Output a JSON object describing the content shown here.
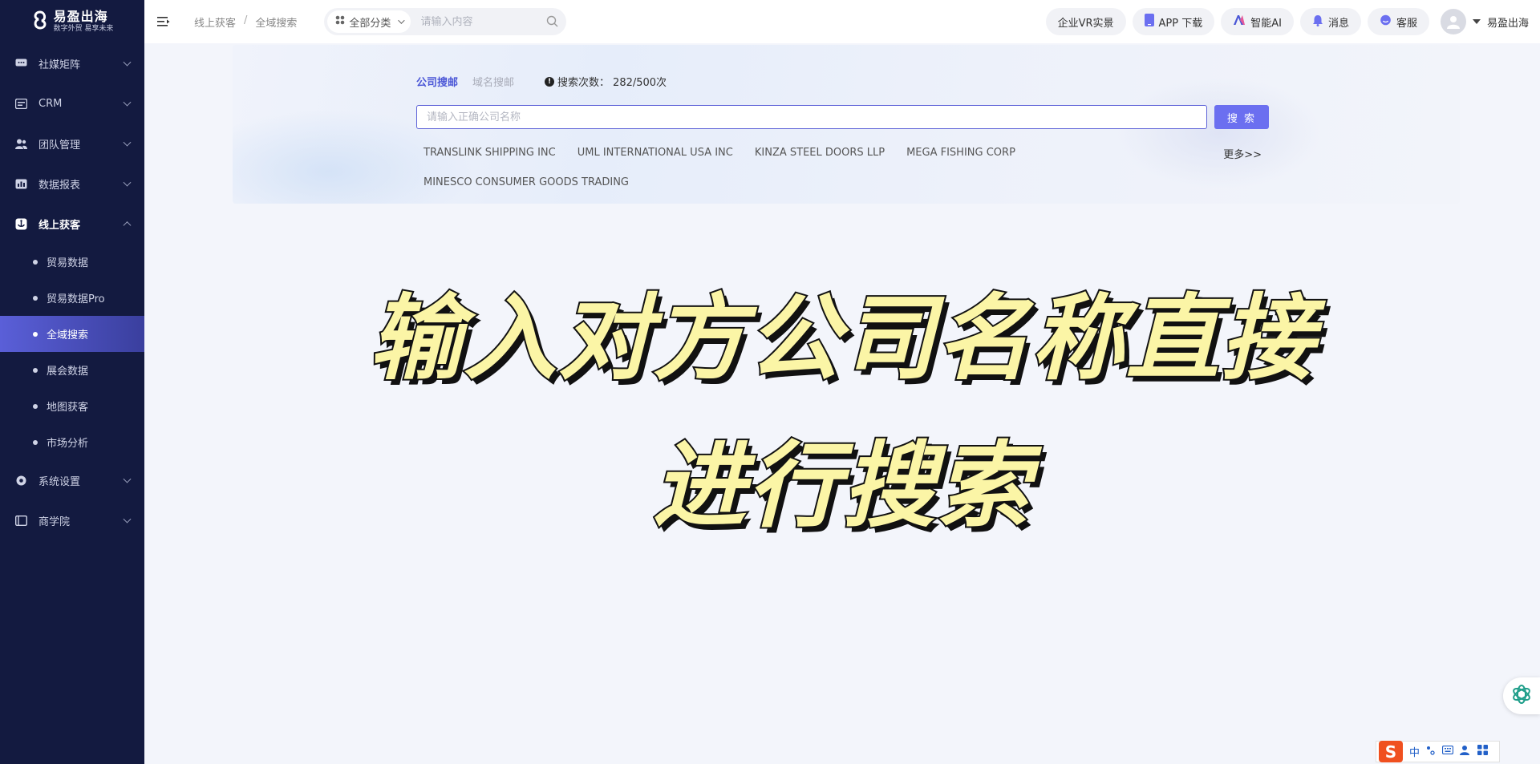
{
  "sidebar": {
    "logo_title": "易盈出海",
    "logo_subtitle": "数字外贸 易享未来",
    "items": [
      {
        "label": "社媒矩阵"
      },
      {
        "label": "CRM"
      },
      {
        "label": "团队管理"
      },
      {
        "label": "数据报表"
      },
      {
        "label": "线上获客"
      }
    ],
    "sub_items": [
      {
        "label": "贸易数据"
      },
      {
        "label": "贸易数据Pro"
      },
      {
        "label": "全域搜索"
      },
      {
        "label": "展会数据"
      },
      {
        "label": "地图获客"
      },
      {
        "label": "市场分析"
      }
    ],
    "bottom_items": [
      {
        "label": "系统设置"
      },
      {
        "label": "商学院"
      }
    ]
  },
  "header": {
    "breadcrumb": [
      "线上获客",
      "全域搜索"
    ],
    "breadcrumb_sep": "/",
    "category": "全部分类",
    "search_placeholder": "请输入内容",
    "buttons": {
      "vr": "企业VR实景",
      "app": "APP 下载",
      "ai": "智能AI",
      "msg": "消息",
      "service": "客服"
    },
    "username": "易盈出海"
  },
  "search_panel": {
    "tab_company": "公司搜邮",
    "tab_domain": "域名搜邮",
    "quota_label": "搜索次数：",
    "quota_value": "282/500次",
    "input_placeholder": "请输入正确公司名称",
    "search_button": "搜 索",
    "suggestions_row1": [
      "TRANSLINK SHIPPING INC",
      "UML INTERNATIONAL USA INC",
      "KINZA STEEL DOORS LLP",
      "MEGA FISHING CORP"
    ],
    "suggestions_row2": [
      "MINESCO CONSUMER GOODS TRADING"
    ],
    "more": "更多>>"
  },
  "caption": {
    "line1": "输入对方公司名称直接",
    "line2": "进行搜索"
  },
  "ime": {
    "logo": "S",
    "mode": "中"
  },
  "colors": {
    "sidebar_bg": "#131a40",
    "accent": "#6b6ff0",
    "active_tab": "#4a56d6",
    "caption_fill": "#fbf5a6"
  }
}
